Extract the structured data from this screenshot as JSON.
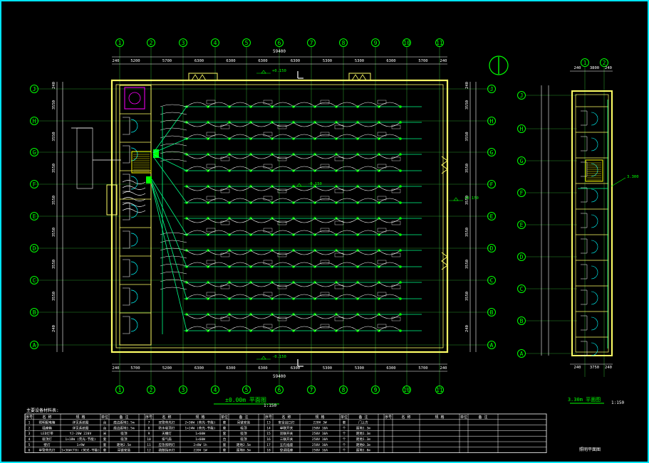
{
  "colors": {
    "background": "#000000",
    "frame": "#00e5ff",
    "wall": "#ffff66",
    "grid_line": "#00ff00",
    "wiring": "#00ff88",
    "arc": "#ffffff",
    "dimension": "#ffffff"
  },
  "main_plan": {
    "column_axes": [
      "1",
      "2",
      "3",
      "4",
      "5",
      "6",
      "7",
      "8",
      "9",
      "10",
      "11"
    ],
    "row_axes": [
      "J",
      "H",
      "G",
      "F",
      "E",
      "D",
      "C",
      "B",
      "A"
    ],
    "top_dim_total": "59400",
    "bottom_dim_total": "59400",
    "top_dims": [
      "240",
      "5200",
      "5700",
      "6300",
      "6300",
      "6300",
      "6300",
      "5300",
      "5300",
      "6300",
      "5700",
      "240"
    ],
    "bottom_dims": [
      "240",
      "5700",
      "5200",
      "6300",
      "6300",
      "6300",
      "6300",
      "5300",
      "5300",
      "6300",
      "5700",
      "240"
    ],
    "left_dims": [
      "240",
      "3550",
      "3550",
      "3550",
      "3550",
      "3550",
      "3550",
      "3550",
      "240"
    ],
    "elev_marks": [
      "+0.150",
      "-0.150",
      "-0.150",
      "+0.150"
    ],
    "title": "±0.00m 平面图",
    "scale": "1:150"
  },
  "side_plan": {
    "column_axes": [
      "1",
      "2"
    ],
    "row_axes": [
      "J",
      "H",
      "G",
      "F",
      "E",
      "D",
      "C",
      "B",
      "A"
    ],
    "top_dims": [
      "240",
      "3800",
      "240"
    ],
    "bottom_dims": [
      "240",
      "3750",
      "240"
    ],
    "elev_mark": "3.300",
    "title": "3.30m 平面图",
    "scale": "1:150"
  },
  "legend": {
    "caption": "主要设备材料表:",
    "headers": [
      "序号",
      "名 称",
      "规 格",
      "单位",
      "备 注"
    ],
    "rows": [
      [
        "1",
        "照明配电箱",
        "详见系统图",
        "台",
        "底边距地1.5m"
      ],
      [
        "2",
        "插座箱",
        "详见系统图",
        "台",
        "底边距地1.5m"
      ],
      [
        "3",
        "LED灯带",
        "YJ-20W 220V",
        "米",
        "吸顶"
      ],
      [
        "4",
        "吸顶灯",
        "1×18W (荧光-节能)",
        "套",
        "吸顶"
      ],
      [
        "5",
        "壁灯",
        "1×9W",
        "套",
        "距地2.5m"
      ],
      [
        "6",
        "单管荧光灯",
        "1×36W(T8) (荧光-节能)",
        "套",
        "吊链安装"
      ],
      [
        "7",
        "双管荧光灯",
        "2×36W (荧光-节能)",
        "套",
        "吊链安装"
      ],
      [
        "8",
        "防水吸顶灯",
        "1×24W (荧光-节能)",
        "套",
        "吸顶"
      ],
      [
        "9",
        "天棚灯",
        "1×60W",
        "套",
        "吸顶"
      ],
      [
        "10",
        "排气扇",
        "1×60W",
        "台",
        "吸顶"
      ],
      [
        "11",
        "应急照明灯",
        "2×8W 1h",
        "套",
        "距地2.5m"
      ],
      [
        "12",
        "疏散指示灯",
        "220V 1W",
        "套",
        "距地0.5m"
      ],
      [
        "13",
        "安全出口灯",
        "220V 3W",
        "套",
        "门上方"
      ],
      [
        "14",
        "单联开关",
        "250V 10A",
        "个",
        "距地1.3m"
      ],
      [
        "15",
        "双联开关",
        "250V 10A",
        "个",
        "距地1.3m"
      ],
      [
        "16",
        "三联开关",
        "250V 10A",
        "个",
        "距地1.3m"
      ],
      [
        "17",
        "五孔插座",
        "250V 10A",
        "个",
        "距地0.3m"
      ],
      [
        "18",
        "空调插座",
        "250V 16A",
        "个",
        "距地1.8m"
      ]
    ],
    "note": "照明平面图"
  }
}
